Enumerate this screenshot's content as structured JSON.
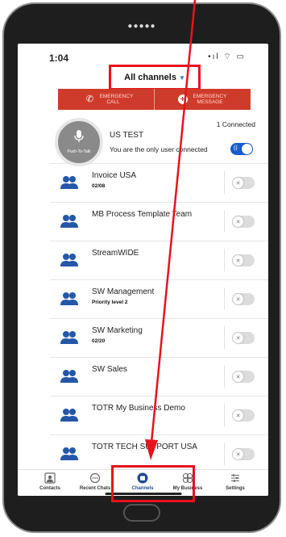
{
  "status": {
    "time": "1:04",
    "icons": "•ıl ⌔ ▭"
  },
  "header": {
    "channel_selector": "All channels"
  },
  "emergency": {
    "call": "EMERGENCY CALL",
    "message": "EMERGENCY MESSAGE"
  },
  "current_channel": {
    "name": "US TEST",
    "subtitle": "You are the only user connected",
    "connected": "1 Connected",
    "ptt_label": "Push-To-Talk",
    "toggle": "on"
  },
  "channels": [
    {
      "name": "Invoice USA",
      "sub": "02/08"
    },
    {
      "name": "MB Process Template Team",
      "sub": ""
    },
    {
      "name": "StreamWIDE",
      "sub": ""
    },
    {
      "name": "SW Management",
      "sub": "Priority level 2"
    },
    {
      "name": "SW Marketing",
      "sub": "02/20"
    },
    {
      "name": "SW Sales",
      "sub": ""
    },
    {
      "name": "TOTR My Business Demo",
      "sub": ""
    },
    {
      "name": "TOTR TECH SUPPORT USA",
      "sub": ""
    }
  ],
  "tabs": [
    {
      "label": "Contacts"
    },
    {
      "label": "Recent Chats"
    },
    {
      "label": "Channels"
    },
    {
      "label": "My Business"
    },
    {
      "label": "Settings"
    }
  ],
  "colors": {
    "accent": "#1a5ad1",
    "emergency": "#cf3b2a",
    "highlight": "#e8121c"
  }
}
